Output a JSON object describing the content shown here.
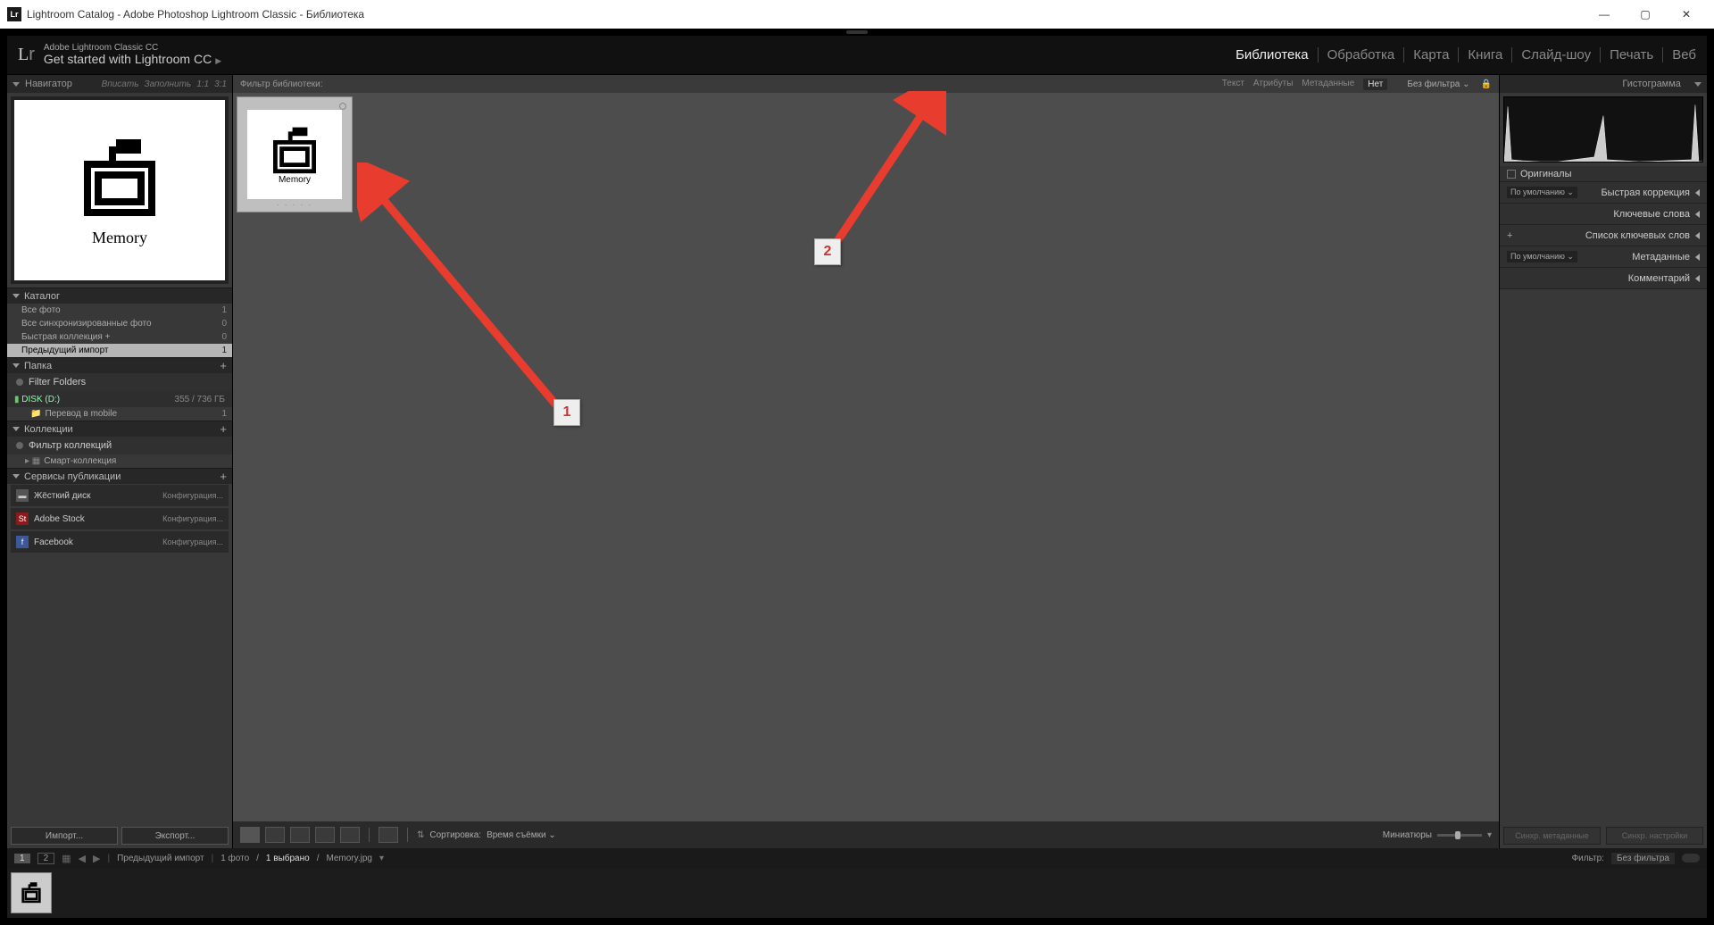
{
  "window": {
    "title": "Lightroom Catalog - Adobe Photoshop Lightroom Classic - Библиотека",
    "app_badge": "Lr"
  },
  "header": {
    "product_line": "Adobe Lightroom Classic CC",
    "get_started": "Get started with Lightroom CC",
    "modules": [
      "Библиотека",
      "Обработка",
      "Карта",
      "Книга",
      "Слайд-шоу",
      "Печать",
      "Веб"
    ],
    "active_module": 0
  },
  "left": {
    "navigator": {
      "title": "Навигатор",
      "fit": "Вписать",
      "fill": "Заполнить",
      "r11": "1:1",
      "r31": "3:1"
    },
    "preview_caption": "Memory",
    "catalog": {
      "title": "Каталог",
      "items": [
        {
          "label": "Все фото",
          "count": "1"
        },
        {
          "label": "Все синхронизированные фото",
          "count": "0"
        },
        {
          "label": "Быстрая коллекция  +",
          "count": "0"
        },
        {
          "label": "Предыдущий импорт",
          "count": "1",
          "selected": true
        }
      ]
    },
    "folders": {
      "title": "Папка",
      "filter": "Filter Folders",
      "disk": "DISK (D:)",
      "disk_size": "355 / 736 ГБ",
      "sub": "Перевод в mobile",
      "sub_count": "1"
    },
    "collections": {
      "title": "Коллекции",
      "filter": "Фильтр коллекций",
      "smart": "Смарт-коллекция"
    },
    "publish": {
      "title": "Сервисы публикации",
      "items": [
        {
          "name": "Жёсткий диск",
          "cfg": "Конфигурация...",
          "icon": "disk"
        },
        {
          "name": "Adobe Stock",
          "cfg": "Конфигурация...",
          "icon": "st"
        },
        {
          "name": "Facebook",
          "cfg": "Конфигурация...",
          "icon": "fb"
        }
      ]
    },
    "import_btn": "Импорт...",
    "export_btn": "Экспорт..."
  },
  "center": {
    "filter_label": "Фильтр библиотеки:",
    "tabs": {
      "text": "Текст",
      "attr": "Атрибуты",
      "meta": "Метаданные",
      "none": "Нет"
    },
    "no_filter": "Без фильтра",
    "thumb_caption": "Memory",
    "toolbar": {
      "sort": "Сортировка:",
      "sort_val": "Время съёмки",
      "thumbnails": "Миниатюры"
    }
  },
  "right": {
    "histogram": "Гистограмма",
    "originals": "Оригиналы",
    "default": "По умолчанию",
    "quick": "Быстрая коррекция",
    "keywords": "Ключевые слова",
    "keyword_list": "Список ключевых слов",
    "metadata": "Метаданные",
    "comments": "Комментарий",
    "sync_meta": "Синхр. метаданные",
    "sync_settings": "Синхр. настройки"
  },
  "filmstrip": {
    "prev_import": "Предыдущий импорт",
    "count": "1 фото",
    "selected": "1 выбрано",
    "filename": "Memory.jpg",
    "filter": "Фильтр:",
    "no_filter": "Без фильтра"
  },
  "annotations": {
    "one": "1",
    "two": "2"
  }
}
